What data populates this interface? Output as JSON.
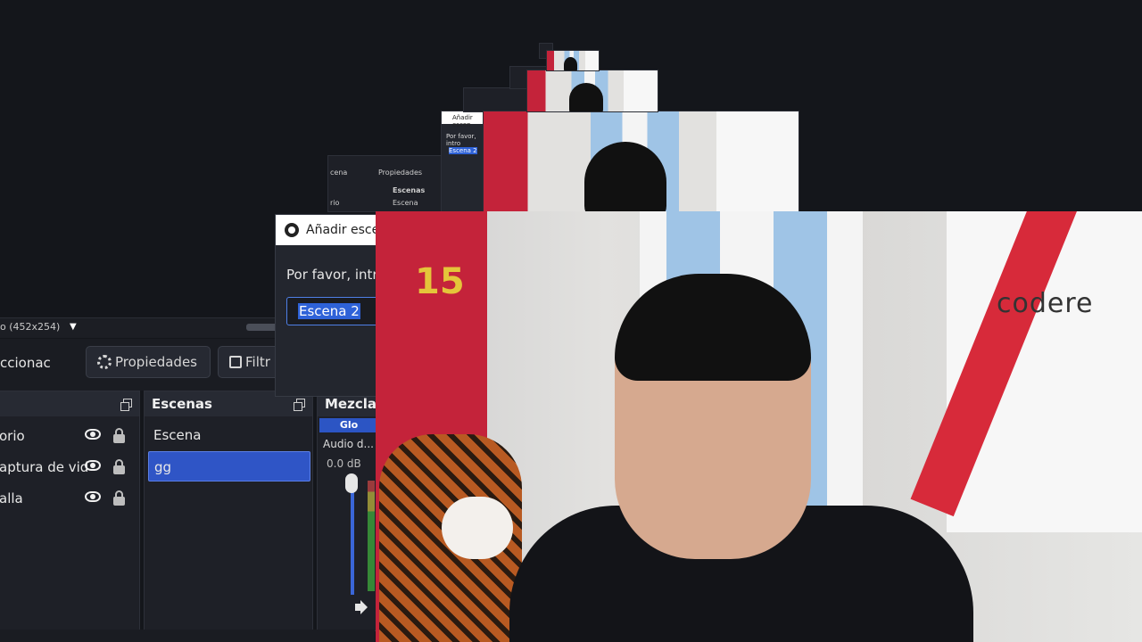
{
  "statusbar": {
    "resolution_text": "o (452x254)"
  },
  "toolbar": {
    "cut_label": "ccionac",
    "properties_label": "Propiedades",
    "filters_label": "Filtr"
  },
  "sources": {
    "items": [
      {
        "label": "orio"
      },
      {
        "label": "aptura de vid"
      },
      {
        "label": "alla"
      }
    ]
  },
  "scenes": {
    "title": "Escenas",
    "items": [
      {
        "label": "Escena",
        "selected": false
      },
      {
        "label": "gg",
        "selected": true
      }
    ]
  },
  "mixer": {
    "title": "Mezclac",
    "tab_label": "Glo",
    "channel_name": "Audio d...",
    "level_text": "0.0 dB"
  },
  "dialog": {
    "title": "Añadir escen",
    "prompt": "Por favor, intro",
    "input_value": "Escena 2"
  },
  "webcam": {
    "jersey_number": "15",
    "sponsor_text": "codere"
  },
  "ghosts": {
    "g1_tab_a": "cena",
    "g1_tab_b": "Propiedades",
    "g1_head": "Escenas",
    "g1_row1": "Escena",
    "g1_row0": "rio",
    "g2_title": "Añadir escen",
    "g2_prompt": "Por favor, intro",
    "g2_input": "Escena 2"
  },
  "colors": {
    "accent": "#2f55c6",
    "background": "#14161b",
    "panel": "#1e2027"
  }
}
